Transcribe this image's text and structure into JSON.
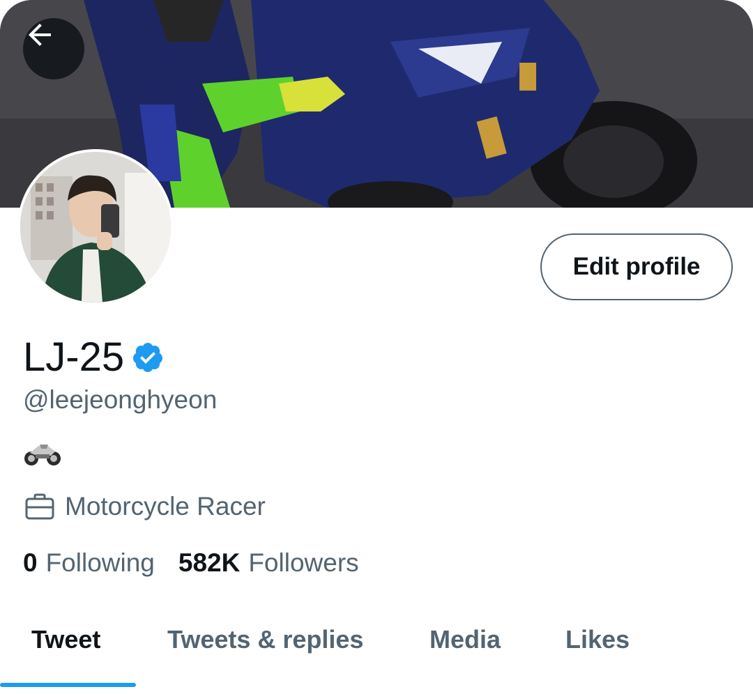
{
  "header": {
    "back_icon": "arrow-left-icon",
    "banner_image": "motorcycle-racer-banner"
  },
  "profile": {
    "avatar_image": "mirror-selfie-avatar",
    "display_name": "LJ-25",
    "verified": true,
    "verified_icon": "verified-badge-icon",
    "handle": "@leejeonghyeon",
    "bio_icon": "motorcycle-emoji-icon",
    "job_icon": "briefcase-icon",
    "job": "Motorcycle Racer",
    "edit_profile_label": "Edit profile"
  },
  "stats": {
    "following_count": "0",
    "following_label": "Following",
    "followers_count": "582K",
    "followers_label": "Followers"
  },
  "tabs": [
    {
      "label": "Tweet",
      "active": true
    },
    {
      "label": "Tweets & replies",
      "active": false
    },
    {
      "label": "Media",
      "active": false
    },
    {
      "label": "Likes",
      "active": false
    }
  ],
  "colors": {
    "accent": "#1d9bf0",
    "text_primary": "#0f1419",
    "text_secondary": "#536471",
    "border": "#536471",
    "rider_green": "#5fd12c",
    "bike_blue": "#1f2a6e"
  }
}
